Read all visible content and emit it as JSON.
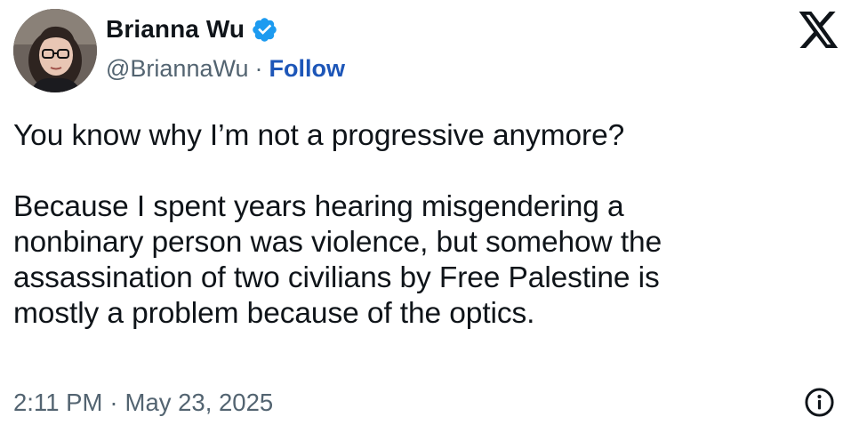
{
  "author": {
    "name": "Brianna Wu",
    "handle": "@BriannaWu",
    "separator": "·",
    "follow_label": "Follow",
    "verified_color": "#1d9bf0"
  },
  "tweet": {
    "lines_first": [
      "You know why I’m not a progressive anymore?"
    ],
    "lines_second": [
      "Because I spent years hearing misgendering a",
      "nonbinary person was violence, but somehow the",
      "assassination of two civilians by Free Palestine is",
      "mostly a problem because of the optics."
    ]
  },
  "meta": {
    "time": "2:11 PM",
    "separator": "·",
    "date": "May 23, 2025"
  },
  "icons": {
    "platform": "x-logo-icon",
    "info": "info-icon",
    "verified": "verified-badge-icon"
  }
}
